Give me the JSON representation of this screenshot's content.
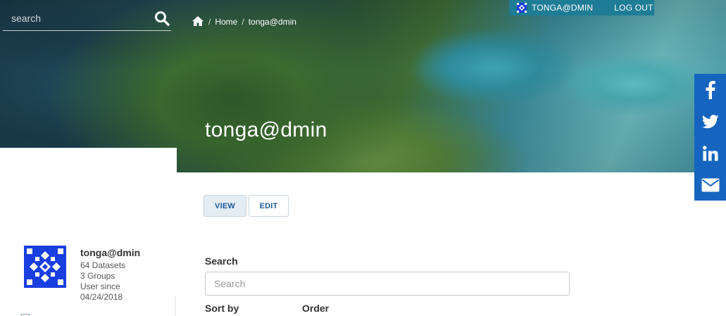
{
  "header": {
    "search_placeholder": "search",
    "breadcrumb": [
      {
        "label": "Home"
      },
      {
        "label": "tonga@dmin"
      }
    ],
    "account": {
      "username": "TONGA@DMIN",
      "logout_label": "LOG OUT"
    },
    "hero_title": "tonga@dmin"
  },
  "share_icons": [
    "facebook-icon",
    "twitter-icon",
    "linkedin-icon",
    "email-icon"
  ],
  "tabs": [
    {
      "label": "VIEW",
      "active": true
    },
    {
      "label": "EDIT",
      "active": false
    }
  ],
  "profile": {
    "name": "tonga@dmin",
    "datasets": "64 Datasets",
    "groups": "3 Groups",
    "user_since_label": "User since",
    "user_since_date": "04/24/2018"
  },
  "filters": {
    "search_label": "Search",
    "search_placeholder": "Search",
    "sort_label": "Sort by",
    "order_label": "Order"
  },
  "colors": {
    "accent": "#1e7c96",
    "share_bar": "#1565c0",
    "avatar": "#1a3fe0"
  }
}
